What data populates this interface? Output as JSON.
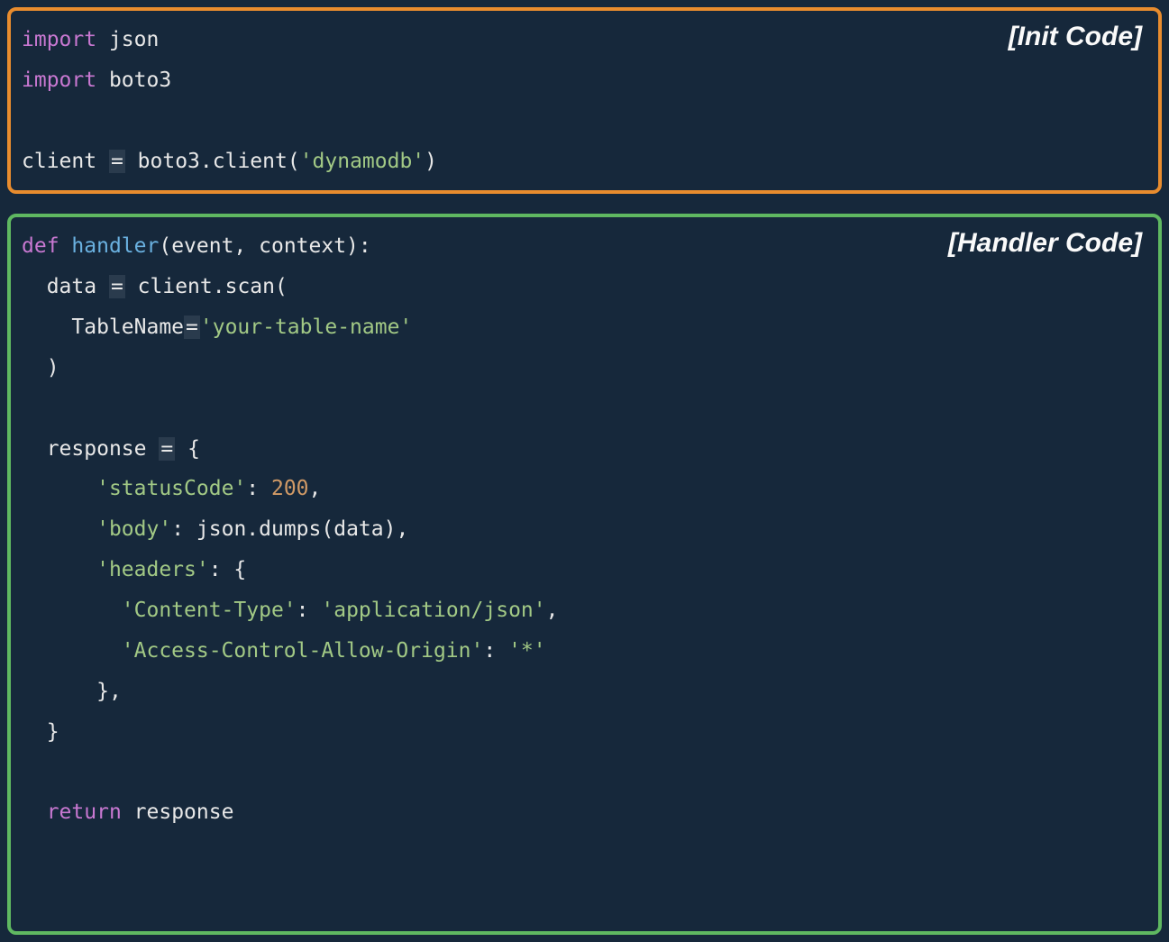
{
  "labels": {
    "init": "[Init Code]",
    "handler": "[Handler Code]"
  },
  "colors": {
    "init_border": "#e88c2e",
    "handler_border": "#5fb861",
    "background": "#16283b"
  },
  "code": {
    "import_kw": "import",
    "json_mod": "json",
    "boto3_mod": "boto3",
    "client_var": "client",
    "eq": "=",
    "boto3_client_call": "boto3.client(",
    "dynamodb_str": "'dynamodb'",
    "close_paren": ")",
    "def_kw": "def",
    "handler_name": "handler",
    "handler_params": "(event, context):",
    "data_var": "data",
    "client_scan": "client.scan(",
    "tablename_kw": "TableName",
    "tablename_str": "'your-table-name'",
    "response_var": "response",
    "open_brace": "{",
    "statuscode_key": "'statusCode'",
    "colon": ":",
    "status_200": "200",
    "comma": ",",
    "body_key": "'body'",
    "json_dumps": "json.dumps(data),",
    "headers_key": "'headers'",
    "headers_open": ": {",
    "content_type_key": "'Content-Type'",
    "content_type_val": "'application/json'",
    "cors_key": "'Access-Control-Allow-Origin'",
    "cors_val": "'*'",
    "close_brace_comma": "},",
    "close_brace": "}",
    "return_kw": "return",
    "response_ident": "response"
  }
}
